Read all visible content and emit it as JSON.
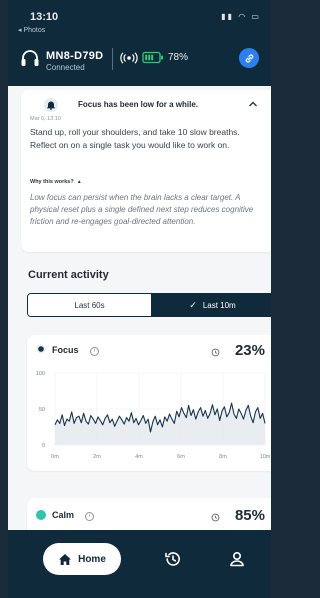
{
  "status": {
    "time": "13:10",
    "back_label": "◂ Photos"
  },
  "device": {
    "name": "MN8-D79D",
    "status": "Connected",
    "battery": "78%"
  },
  "notice": {
    "title": "Focus has been low for a while.",
    "date": "Mar 6, 13:10",
    "body": "Stand up, roll your shoulders, and take 10 slow breaths. Reflect on on a single task you would like to work on.",
    "why_label": "Why this works?",
    "why_body": "Low focus can persist when the brain lacks a clear target. A physical reset plus a single defined next step reduces cognitive friction and re-engages goal-directed attention."
  },
  "activity": {
    "title": "Current activity",
    "tabs": [
      {
        "label": "Last 60s",
        "selected": false
      },
      {
        "label": "Last 10m",
        "selected": true
      }
    ]
  },
  "focus": {
    "label": "Focus",
    "value": "23%"
  },
  "calm": {
    "label": "Calm",
    "value": "85%"
  },
  "nav": {
    "home_label": "Home"
  },
  "chart_data": {
    "type": "line",
    "series": [
      {
        "name": "Focus",
        "color": "#16354a",
        "values": [
          28,
          35,
          30,
          42,
          27,
          36,
          33,
          46,
          30,
          38,
          40,
          31,
          44,
          33,
          29,
          41,
          36,
          30,
          39,
          34,
          28,
          37,
          42,
          31,
          36,
          26,
          33,
          40,
          35,
          29,
          38,
          33,
          45,
          31,
          37,
          28,
          34,
          41,
          30,
          36,
          18,
          32,
          40,
          28,
          35,
          25,
          39,
          33,
          43,
          36,
          30,
          47,
          39,
          52,
          44,
          38,
          55,
          41,
          49,
          36,
          46,
          52,
          40,
          48,
          37,
          44,
          56,
          42,
          50,
          34,
          47,
          53,
          39,
          45,
          58,
          43,
          37,
          50,
          44,
          36,
          48,
          55,
          40,
          31,
          46,
          52,
          37,
          44,
          30
        ]
      }
    ],
    "x_ticks": [
      "0m",
      "2m",
      "4m",
      "6m",
      "8m",
      "10m"
    ],
    "y_ticks": [
      "100",
      "50",
      "0"
    ],
    "ylim": [
      0,
      100
    ]
  }
}
